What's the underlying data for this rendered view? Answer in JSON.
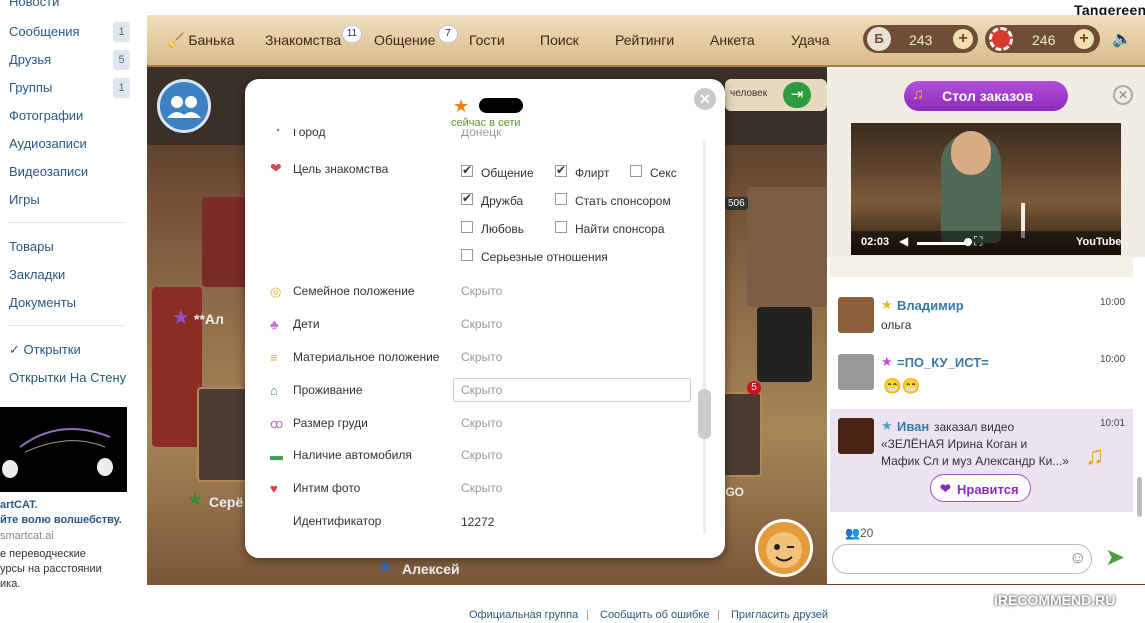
{
  "sidebar": {
    "items_top": [
      {
        "label": "Новости",
        "count": ""
      },
      {
        "label": "Сообщения",
        "count": "1"
      },
      {
        "label": "Друзья",
        "count": "5"
      },
      {
        "label": "Группы",
        "count": "1"
      },
      {
        "label": "Фотографии",
        "count": ""
      },
      {
        "label": "Аудиозаписи",
        "count": ""
      },
      {
        "label": "Видеозаписи",
        "count": ""
      },
      {
        "label": "Игры",
        "count": ""
      }
    ],
    "items_mid": [
      "Товары",
      "Закладки",
      "Документы"
    ],
    "items_bottom": [
      "✓ Открытки",
      "Открытки На Стену"
    ],
    "ad": {
      "title": "artCAT.",
      "subtitle": "йте волю волшебству.",
      "domain": "smartcat.ai",
      "text1": "е переводческие",
      "text2": "урсы на расстоянии",
      "text3": "ика."
    }
  },
  "topbar": {
    "nav": [
      "Банька",
      "Знакомства",
      "Общение",
      "Гости",
      "Поиск",
      "Рейтинги",
      "Анкета",
      "Удача"
    ],
    "badge_znakomstva": "11",
    "badge_obshchenie": "7",
    "coins": "243",
    "chips": "246",
    "username": "Tangereen"
  },
  "scene": {
    "people_count": "человек",
    "label_alexei": "Алексей",
    "label_sere": "Серё",
    "label_al": "Ал",
    "label_go": "IGO",
    "badge_506": "506",
    "badge_5": "5"
  },
  "modal": {
    "status": "сейчас в сети",
    "city_label": "Город",
    "city_value": "Донецк",
    "goal_label": "Цель знакомства",
    "goals": [
      {
        "label": "Общение",
        "checked": true
      },
      {
        "label": "Флирт",
        "checked": true
      },
      {
        "label": "Секс",
        "checked": false
      },
      {
        "label": "Дружба",
        "checked": true
      },
      {
        "label": "Стать спонсором",
        "checked": false
      },
      {
        "label": "Любовь",
        "checked": false
      },
      {
        "label": "Найти спонсора",
        "checked": false
      },
      {
        "label": "Серьезные отношения",
        "checked": false
      }
    ],
    "fields": [
      {
        "label": "Семейное положение",
        "value": "Скрыто",
        "icon": "rings-icon"
      },
      {
        "label": "Дети",
        "value": "Скрыто",
        "icon": "stroller-icon"
      },
      {
        "label": "Материальное положение",
        "value": "Скрыто",
        "icon": "coins-icon"
      },
      {
        "label": "Проживание",
        "value": "Скрыто",
        "icon": "house-icon"
      },
      {
        "label": "Размер груди",
        "value": "Скрыто",
        "icon": "bra-icon"
      },
      {
        "label": "Наличие автомобиля",
        "value": "Скрыто",
        "icon": "car-icon"
      },
      {
        "label": "Интим фото",
        "value": "Скрыто",
        "icon": "strawberry-icon"
      },
      {
        "label": "Идентификатор",
        "value": "12272",
        "icon": ""
      }
    ]
  },
  "rpanel": {
    "order_table": "Стол заказов",
    "video_time": "02:03",
    "youtube": "YouTube",
    "messages": [
      {
        "name": "Владимир",
        "text": "ольга",
        "time": "10:00"
      },
      {
        "name": "=ПО_КУ_ИСТ=",
        "text": "",
        "time": "10:00"
      },
      {
        "name": "Иван",
        "text": "заказал видео",
        "time": "10:01"
      }
    ],
    "video_title1": "«ЗЕЛЁНАЯ   Ирина Коган и",
    "video_title2": "Мафик Сл и муз  Александр Ки...»",
    "like": "Нравится",
    "online": "20"
  },
  "footer": {
    "links": [
      "Официальная группа",
      "Сообщить об ошибке",
      "Пригласить друзей"
    ],
    "sep": "|"
  },
  "watermark": "iRECOMMEND.RU"
}
